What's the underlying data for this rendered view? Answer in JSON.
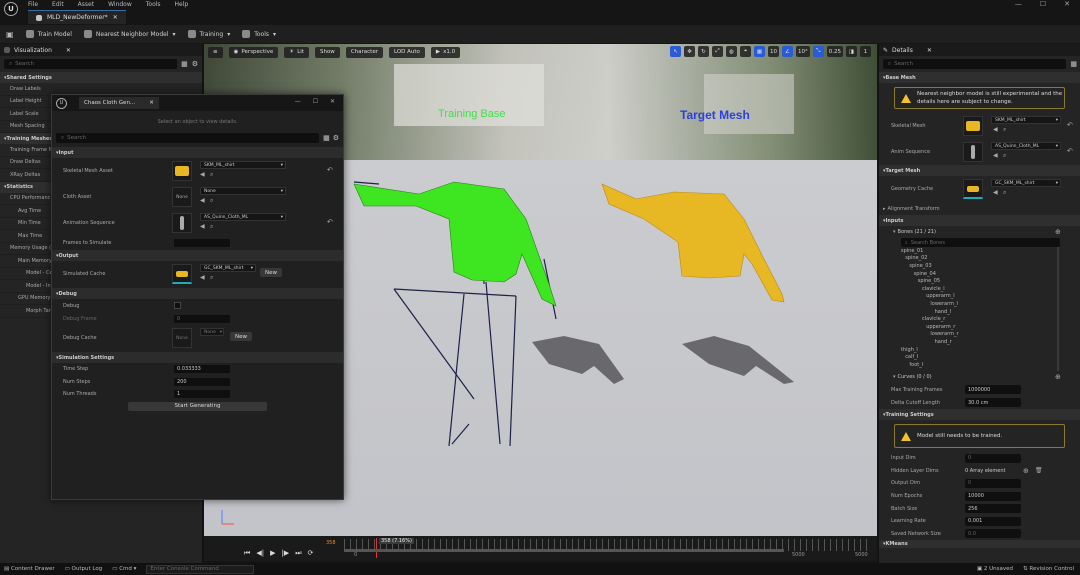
{
  "menu": {
    "items": [
      "File",
      "Edit",
      "Asset",
      "Window",
      "Tools",
      "Help"
    ]
  },
  "doc_tab": {
    "label": "MLD_NewDeformer*"
  },
  "toolbar": {
    "train_model": "Train Model",
    "model_type": "Nearest Neighbor Model",
    "training": "Training",
    "tools": "Tools"
  },
  "left_panel": {
    "tab": "Visualization",
    "search_placeholder": "Search",
    "sections": {
      "shared": "Shared Settings",
      "training_meshes": "Training Meshes",
      "statistics": "Statistics"
    },
    "shared_props": [
      "Draw Labels",
      "Label Height",
      "Label Scale",
      "Mesh Spacing"
    ],
    "training_props": [
      "Training Frame N",
      "Draw Deltas",
      "XRay Deltas"
    ],
    "stat_props": [
      {
        "label": "CPU Performanc",
        "level": 1
      },
      {
        "label": "Avg Time",
        "level": 2
      },
      {
        "label": "Min Time",
        "level": 2
      },
      {
        "label": "Max Time",
        "level": 2
      },
      {
        "label": "Memory Usage (A",
        "level": 1
      },
      {
        "label": "Main Memory",
        "level": 2
      },
      {
        "label": "Model - Ce",
        "level": 3
      },
      {
        "label": "Model - In",
        "level": 3
      },
      {
        "label": "GPU Memory",
        "level": 2
      },
      {
        "label": "Morph Targ",
        "level": 3
      }
    ]
  },
  "viewport": {
    "perspective": "Perspective",
    "lit": "Lit",
    "show": "Show",
    "character": "Character",
    "lod": "LOD Auto",
    "play_rate": "x1.0",
    "grid": "10",
    "angle": "10°",
    "scale": "0.25",
    "cam_speed": "1",
    "label_training": "Training Base",
    "label_target": "Target Mesh"
  },
  "timeline": {
    "current": "358",
    "scrub": "358 (7.16%)",
    "tick_left": "0",
    "tick_mid": "5000",
    "tick_right": "5000"
  },
  "cloth_window": {
    "tab": "Chaos Cloth Gen...",
    "hint": "Select an object to view details.",
    "search_placeholder": "Search",
    "sections": {
      "input": "Input",
      "output": "Output",
      "debug": "Debug",
      "sim": "Simulation Settings"
    },
    "skeletal_mesh_asset": {
      "label": "Skeletal Mesh Asset",
      "value": "SKM_ML_shirt"
    },
    "cloth_asset": {
      "label": "Cloth Asset",
      "value": "None",
      "thumb": "None"
    },
    "anim_seq": {
      "label": "Animation Sequence",
      "value": "AS_Quinn_Cloth_ML"
    },
    "frames": {
      "label": "Frames to Simulate"
    },
    "sim_cache": {
      "label": "Simulated Cache",
      "value": "GC_SKM_ML_shirt",
      "new_btn": "New"
    },
    "debug": {
      "label": "Debug",
      "frame_label": "Debug Frame",
      "frame_value": "0",
      "cache_label": "Debug Cache",
      "cache_value": "None",
      "cache_thumb": "None",
      "new_btn": "New"
    },
    "time_step": {
      "label": "Time Step",
      "value": "0.033333"
    },
    "num_steps": {
      "label": "Num Steps",
      "value": "200"
    },
    "num_threads": {
      "label": "Num Threads",
      "value": "1"
    },
    "start_btn": "Start Generating"
  },
  "details": {
    "tab": "Details",
    "search_placeholder": "Search",
    "base_mesh": "Base Mesh",
    "warn1": "Nearest neighbor model is still experimental and the details here are subject to change.",
    "skeletal_mesh": {
      "label": "Skeletal Mesh",
      "value": "SKM_ML_shirt"
    },
    "anim_seq": {
      "label": "Anim Sequence",
      "value": "AS_Quinn_Cloth_ML"
    },
    "target_mesh": "Target Mesh",
    "geometry_cache": {
      "label": "Geometry Cache",
      "value": "GC_SKM_ML_shirt"
    },
    "alignment": "Alignment Transform",
    "inputs": "Inputs",
    "bones": "Bones (21 / 21)",
    "search_bones": "Search Bones",
    "bone_tree": [
      {
        "n": "spine_01",
        "l": 0
      },
      {
        "n": "spine_02",
        "l": 1
      },
      {
        "n": "spine_03",
        "l": 2
      },
      {
        "n": "spine_04",
        "l": 3
      },
      {
        "n": "spine_05",
        "l": 4
      },
      {
        "n": "clavicle_l",
        "l": 5
      },
      {
        "n": "upperarm_l",
        "l": 6
      },
      {
        "n": "lowerarm_l",
        "l": 7
      },
      {
        "n": "hand_l",
        "l": 8
      },
      {
        "n": "clavicle_r",
        "l": 5
      },
      {
        "n": "upperarm_r",
        "l": 6
      },
      {
        "n": "lowerarm_r",
        "l": 7
      },
      {
        "n": "hand_r",
        "l": 8
      },
      {
        "n": "thigh_l",
        "l": 0
      },
      {
        "n": "calf_l",
        "l": 1
      },
      {
        "n": "foot_l",
        "l": 2
      }
    ],
    "curves": "Curves (0 / 0)",
    "max_frames": {
      "label": "Max Training Frames",
      "value": "1000000"
    },
    "delta_cutoff": {
      "label": "Delta Cutoff Length",
      "value": "30.0 cm"
    },
    "training_settings": "Training Settings",
    "warn2": "Model still needs to be trained.",
    "input_dim": {
      "label": "Input Dim",
      "value": "0"
    },
    "hidden_layer": {
      "label": "Hidden Layer Dims",
      "value": "0 Array element"
    },
    "output_dim": {
      "label": "Output Dim",
      "value": "0"
    },
    "num_epochs": {
      "label": "Num Epochs",
      "value": "10000"
    },
    "batch_size": {
      "label": "Batch Size",
      "value": "256"
    },
    "learning_rate": {
      "label": "Learning Rate",
      "value": "0.001"
    },
    "saved_network": {
      "label": "Saved Network Size",
      "value": "0.0"
    },
    "kmeans": "KMeans"
  },
  "status": {
    "content_drawer": "Content Drawer",
    "output_log": "Output Log",
    "cmd": "Cmd",
    "console_placeholder": "Enter Console Command",
    "unsaved": "2 Unsaved",
    "revision": "Revision Control"
  },
  "colors": {
    "accent_blue": "#2a5bd7",
    "warn": "#f2c12e",
    "training_green": "#3fe04a",
    "target_blue": "#2c3fe0",
    "shirt_yellow": "#e7b823"
  }
}
